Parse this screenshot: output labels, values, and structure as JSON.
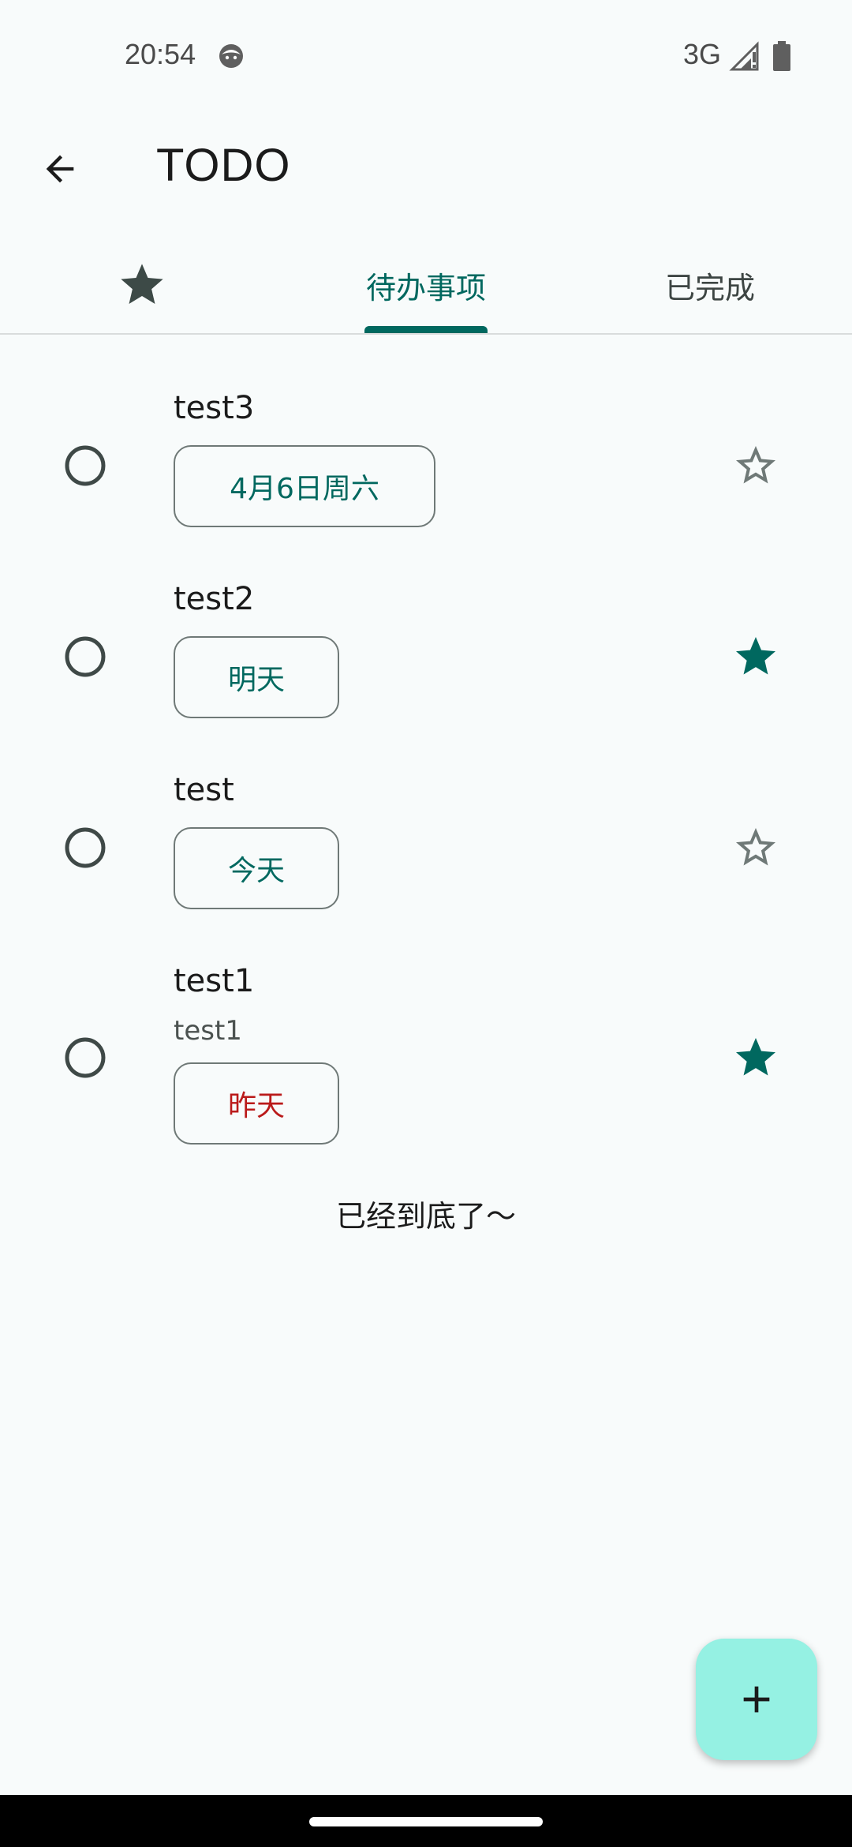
{
  "status_bar": {
    "time": "20:54",
    "network": "3G",
    "icons": [
      "face-notification-icon",
      "signal-icon",
      "battery-icon"
    ]
  },
  "app_bar": {
    "title": "TODO",
    "back_icon": "arrow-back-icon"
  },
  "tabs": {
    "starred_icon": "star-icon",
    "todo_label": "待办事项",
    "done_label": "已完成",
    "selected": "todo_label"
  },
  "tasks": [
    {
      "title": "test3",
      "note": "",
      "date": "4月6日周六",
      "date_status": "future",
      "starred": false
    },
    {
      "title": "test2",
      "note": "",
      "date": "明天",
      "date_status": "future",
      "starred": true
    },
    {
      "title": "test",
      "note": "",
      "date": "今天",
      "date_status": "today",
      "starred": false
    },
    {
      "title": "test1",
      "note": "test1",
      "date": "昨天",
      "date_status": "overdue",
      "starred": true
    }
  ],
  "list_end_text": "已经到底了～",
  "fab": {
    "icon": "plus-icon"
  },
  "colors": {
    "primary": "#00685f",
    "fab_background": "#95f1e3",
    "overdue": "#ba1a1a",
    "background": "#f8fbfb"
  }
}
